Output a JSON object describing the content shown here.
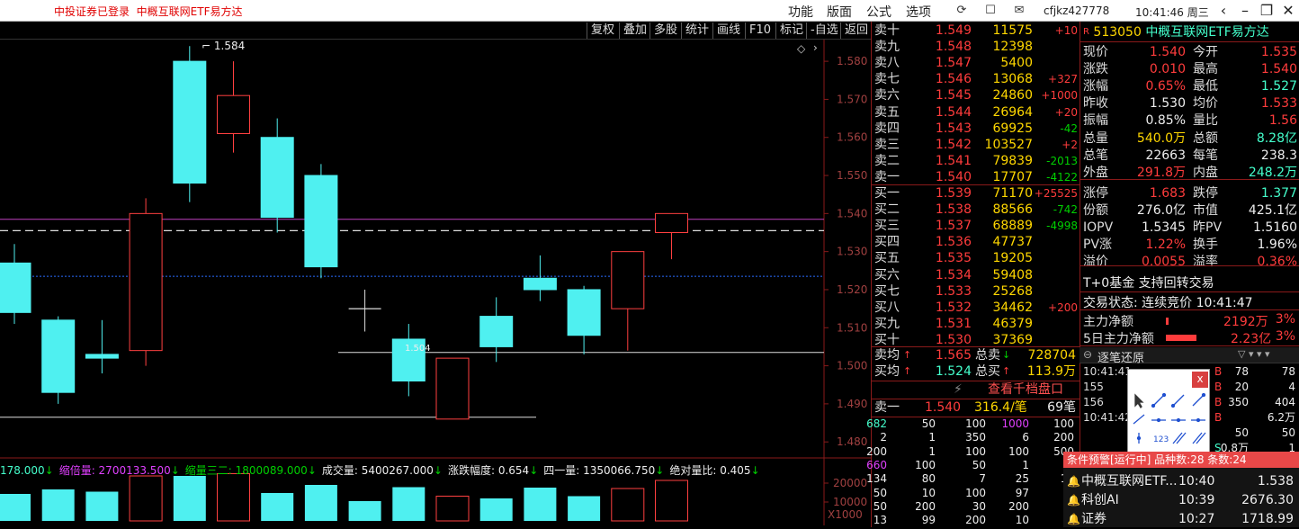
{
  "topbar": {
    "broker_status": "中投证券已登录",
    "security_name": "中概互联网ETF易方达",
    "menus": [
      "功能",
      "版面",
      "公式",
      "选项"
    ],
    "user": "cfjkz427778",
    "time": "10:41:46 周三",
    "icons": [
      "refresh-icon",
      "message-icon",
      "mail-icon",
      "back-icon",
      "minimize-icon",
      "restore-icon",
      "close-icon"
    ]
  },
  "toolbar": [
    "复权",
    "叠加",
    "多股",
    "统计",
    "画线",
    "F10",
    "标记",
    "-自选",
    "返回"
  ],
  "chart_data": {
    "type": "candlestick",
    "y_ticks": [
      "1.580",
      "1.570",
      "1.560",
      "1.550",
      "1.540",
      "1.530",
      "1.520",
      "1.510",
      "1.500",
      "1.490",
      "1.480"
    ],
    "ylim": [
      1.4765,
      1.5857
    ],
    "candles": [
      {
        "o": 1.527,
        "c": 1.514,
        "h": 1.532,
        "l": 1.511,
        "dir": "down"
      },
      {
        "o": 1.512,
        "c": 1.493,
        "h": 1.513,
        "l": 1.49,
        "dir": "down"
      },
      {
        "o": 1.503,
        "c": 1.502,
        "h": 1.512,
        "l": 1.498,
        "dir": "down"
      },
      {
        "o": 1.504,
        "c": 1.54,
        "h": 1.544,
        "l": 1.5,
        "dir": "up"
      },
      {
        "o": 1.58,
        "c": 1.548,
        "h": 1.584,
        "l": 1.543,
        "dir": "down"
      },
      {
        "o": 1.561,
        "c": 1.571,
        "h": 1.58,
        "l": 1.556,
        "dir": "up"
      },
      {
        "o": 1.56,
        "c": 1.539,
        "h": 1.565,
        "l": 1.535,
        "dir": "down"
      },
      {
        "o": 1.55,
        "c": 1.526,
        "h": 1.553,
        "l": 1.523,
        "dir": "down"
      },
      {
        "o": 1.515,
        "c": 1.515,
        "h": 1.52,
        "l": 1.509,
        "dir": "flat"
      },
      {
        "o": 1.507,
        "c": 1.496,
        "h": 1.511,
        "l": 1.492,
        "dir": "down"
      },
      {
        "o": 1.486,
        "c": 1.502,
        "h": 1.502,
        "l": 1.486,
        "dir": "up"
      },
      {
        "o": 1.513,
        "c": 1.505,
        "h": 1.518,
        "l": 1.501,
        "dir": "down"
      },
      {
        "o": 1.523,
        "c": 1.52,
        "h": 1.529,
        "l": 1.517,
        "dir": "down"
      },
      {
        "o": 1.52,
        "c": 1.508,
        "h": 1.521,
        "l": 1.503,
        "dir": "down"
      },
      {
        "o": 1.515,
        "c": 1.53,
        "h": 1.53,
        "l": 1.504,
        "dir": "up"
      },
      {
        "o": 1.535,
        "c": 1.54,
        "h": 1.54,
        "l": 1.528,
        "dir": "up"
      }
    ],
    "annotations": [
      {
        "text": "1.584"
      },
      {
        "text": "1.504"
      }
    ],
    "volume_ticks": [
      "20000",
      "10000"
    ],
    "volume_unit": "X1000",
    "volumes": [
      0.6,
      0.7,
      0.65,
      1.0,
      1.0,
      1.05,
      0.62,
      0.8,
      0.44,
      0.75,
      0.55,
      0.5,
      0.74,
      0.55,
      0.72,
      0.9
    ]
  },
  "volinfo": [
    {
      "text": "178.000",
      "color": "#4fc",
      "arrow": "↓"
    },
    {
      "text": "缩倍量: 2700133.500",
      "color": "#e040ff",
      "arrow": "↓"
    },
    {
      "text": "缩量三二: 1800089.000",
      "color": "#00d000",
      "arrow": "↓"
    },
    {
      "text": "成交量: 5400267.000",
      "color": "#eee",
      "arrow": "↓"
    },
    {
      "text": "涨跌幅度: 0.654",
      "color": "#eee",
      "arrow": "↓"
    },
    {
      "text": "四一量: 1350066.750",
      "color": "#eee",
      "arrow": "↓"
    },
    {
      "text": "绝对量比: 0.405",
      "color": "#eee",
      "arrow": "↓"
    }
  ],
  "orderbook": {
    "asks": [
      {
        "label": "卖十",
        "price": "1.549",
        "vol": "11575",
        "chg": "+10"
      },
      {
        "label": "卖九",
        "price": "1.548",
        "vol": "12398",
        "chg": ""
      },
      {
        "label": "卖八",
        "price": "1.547",
        "vol": "5400",
        "chg": ""
      },
      {
        "label": "卖七",
        "price": "1.546",
        "vol": "13068",
        "chg": "+327"
      },
      {
        "label": "卖六",
        "price": "1.545",
        "vol": "24860",
        "chg": "+1000"
      },
      {
        "label": "卖五",
        "price": "1.544",
        "vol": "26964",
        "chg": "+20"
      },
      {
        "label": "卖四",
        "price": "1.543",
        "vol": "69925",
        "chg": "-42"
      },
      {
        "label": "卖三",
        "price": "1.542",
        "vol": "103527",
        "chg": "+2"
      },
      {
        "label": "卖二",
        "price": "1.541",
        "vol": "79839",
        "chg": "-2013"
      },
      {
        "label": "卖一",
        "price": "1.540",
        "vol": "17707",
        "chg": "-4122"
      }
    ],
    "bids": [
      {
        "label": "买一",
        "price": "1.539",
        "vol": "71170",
        "chg": "+25525"
      },
      {
        "label": "买二",
        "price": "1.538",
        "vol": "88566",
        "chg": "-742"
      },
      {
        "label": "买三",
        "price": "1.537",
        "vol": "68889",
        "chg": "-4998"
      },
      {
        "label": "买四",
        "price": "1.536",
        "vol": "47737",
        "chg": ""
      },
      {
        "label": "买五",
        "price": "1.535",
        "vol": "19205",
        "chg": ""
      },
      {
        "label": "买六",
        "price": "1.534",
        "vol": "59408",
        "chg": ""
      },
      {
        "label": "买七",
        "price": "1.533",
        "vol": "25268",
        "chg": ""
      },
      {
        "label": "买八",
        "price": "1.532",
        "vol": "34462",
        "chg": "+200"
      },
      {
        "label": "买九",
        "price": "1.531",
        "vol": "46379",
        "chg": ""
      },
      {
        "label": "买十",
        "price": "1.530",
        "vol": "37369",
        "chg": ""
      }
    ],
    "ask_avg": {
      "label": "卖均",
      "price": "1.565",
      "total_label": "总卖",
      "total": "728704"
    },
    "bid_avg": {
      "label": "买均",
      "price": "1.524",
      "total_label": "总买",
      "total": "113.9万"
    },
    "view_thousand": "查看千档盘口",
    "sell1_line": {
      "label": "卖一",
      "price": "1.540",
      "qty": "316.4/笔",
      "count": "69笔"
    }
  },
  "ticks": [
    [
      "682",
      "50",
      "100",
      "1000",
      "100"
    ],
    [
      "2",
      "1",
      "350",
      "6",
      "200"
    ],
    [
      "200",
      "1",
      "100",
      "100",
      "500"
    ],
    [
      "660",
      "100",
      "50",
      "1",
      "1"
    ],
    [
      "134",
      "80",
      "7",
      "25",
      "13"
    ],
    [
      "50",
      "10",
      "100",
      "97",
      "1"
    ],
    [
      "50",
      "200",
      "30",
      "200",
      "1"
    ],
    [
      "13",
      "99",
      "200",
      "10",
      "2"
    ]
  ],
  "quote": {
    "code_badge": "R",
    "code": "513050",
    "name": "中概互联网ETF易方达",
    "rows": [
      {
        "l1": "现价",
        "v1": "1.540",
        "c1": "red",
        "l2": "今开",
        "v2": "1.535",
        "c2": "red"
      },
      {
        "l1": "涨跌",
        "v1": "0.010",
        "c1": "red",
        "l2": "最高",
        "v2": "1.540",
        "c2": "red"
      },
      {
        "l1": "涨幅",
        "v1": "0.65%",
        "c1": "red",
        "l2": "最低",
        "v2": "1.527",
        "c2": "cyan"
      },
      {
        "l1": "昨收",
        "v1": "1.530",
        "c1": "white",
        "l2": "均价",
        "v2": "1.533",
        "c2": "red"
      },
      {
        "l1": "振幅",
        "v1": "0.85%",
        "c1": "white",
        "l2": "量比",
        "v2": "1.56",
        "c2": "red"
      },
      {
        "l1": "总量",
        "v1": "540.0万",
        "c1": "yellow",
        "l2": "总额",
        "v2": "8.28亿",
        "c2": "cyan"
      },
      {
        "l1": "总笔",
        "v1": "22663",
        "c1": "white",
        "l2": "每笔",
        "v2": "238.3",
        "c2": "white"
      },
      {
        "l1": "外盘",
        "v1": "291.8万",
        "c1": "red",
        "l2": "内盘",
        "v2": "248.2万",
        "c2": "cyan"
      },
      {
        "l1": "涨停",
        "v1": "1.683",
        "c1": "red",
        "l2": "跌停",
        "v2": "1.377",
        "c2": "cyan"
      },
      {
        "l1": "份额",
        "v1": "276.0亿",
        "c1": "white",
        "l2": "市值",
        "v2": "425.1亿",
        "c2": "white"
      },
      {
        "l1": "IOPV",
        "v1": "1.5345",
        "c1": "white",
        "l2": "昨PV",
        "v2": "1.5160",
        "c2": "white"
      },
      {
        "l1": "PV涨",
        "v1": "1.22%",
        "c1": "red",
        "l2": "换手",
        "v2": "1.96%",
        "c2": "white"
      },
      {
        "l1": "溢价",
        "v1": "0.0055",
        "c1": "red",
        "l2": "溢率",
        "v2": "0.36%",
        "c2": "red"
      }
    ],
    "tplus": "T+0基金 支持回转交易",
    "trade_status_label": "交易状态:",
    "trade_status": "连续竞价",
    "trade_time": "10:41:47",
    "main_net_label": "主力净额",
    "main_net": "2192万",
    "main_net_pct": "3%",
    "main5_label": "5日主力净额",
    "main5": "2.23亿",
    "main5_pct": "3%",
    "tick_title": "逐笔还原",
    "tick_rows": [
      {
        "t": "10:41:41",
        "n": "",
        "s": "B",
        "v": "78",
        "x": "78"
      },
      {
        "t": "155",
        "n": "",
        "s": "B",
        "v": "20",
        "x": "4"
      },
      {
        "t": "156",
        "n": "",
        "s": "B",
        "v": "350",
        "x": "404"
      },
      {
        "t": "10:41:42",
        "n": "",
        "s": "B",
        "v": "",
        "x": "6.2万"
      },
      {
        "t": "",
        "n": "",
        "s": "",
        "v": "50",
        "x": "50"
      },
      {
        "t": "",
        "n": "",
        "s": "S",
        "v": "0.8万",
        "x": "1"
      }
    ]
  },
  "popup": {
    "close": "x"
  },
  "alert": {
    "header": "条件预警[运行中] 品种数:28 条数:24",
    "rows": [
      {
        "name": "中概互联网ETF...",
        "time": "10:40",
        "price": "1.538"
      },
      {
        "name": "科创AI",
        "time": "10:39",
        "price": "2676.30"
      },
      {
        "name": "证券",
        "time": "10:27",
        "price": "1718.99"
      }
    ]
  }
}
